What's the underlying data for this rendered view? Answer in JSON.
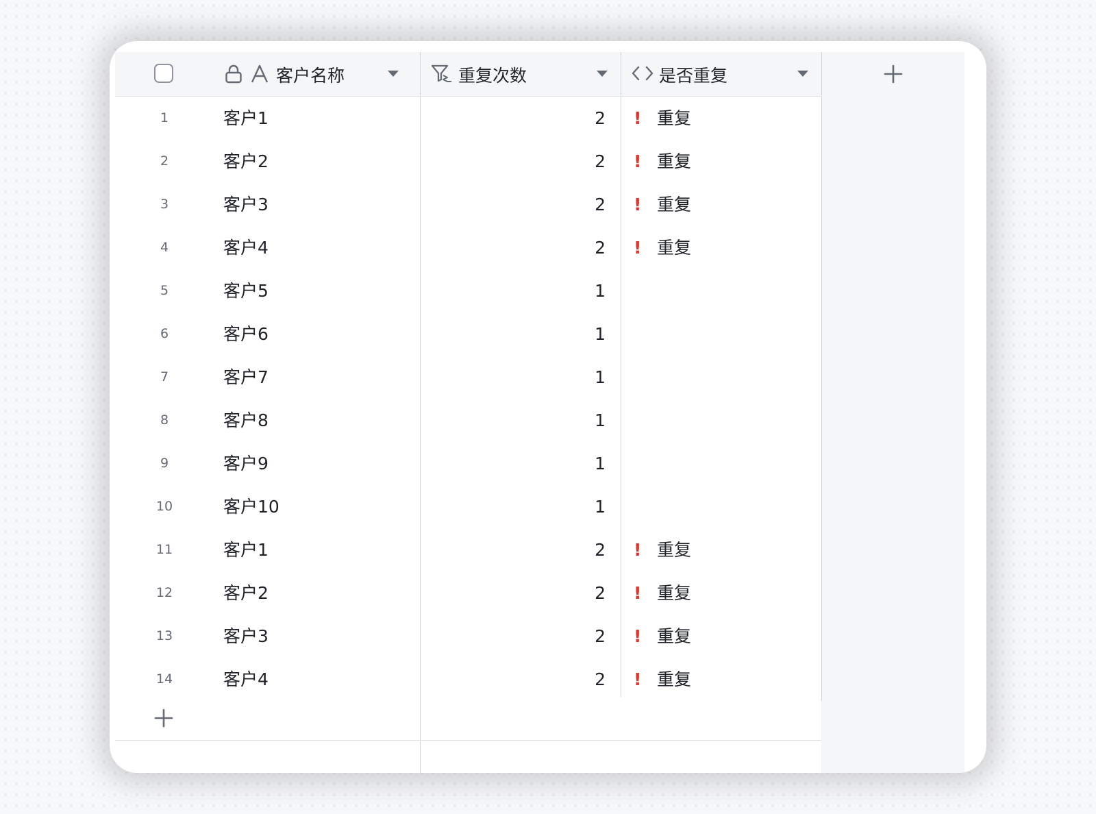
{
  "columns": {
    "name": {
      "label": "客户名称",
      "icons": [
        "lock-icon",
        "text-field-icon"
      ]
    },
    "count": {
      "label": "重复次数",
      "icons": [
        "filter-formula-icon"
      ]
    },
    "dup": {
      "label": "是否重复",
      "icons": [
        "code-icon"
      ]
    }
  },
  "colors": {
    "alert": "#d83931",
    "header_bg": "#f5f6f8",
    "border": "#dee0e3"
  },
  "rows": [
    {
      "index": "1",
      "name": "客户1",
      "count": "2",
      "flag": "!",
      "dup": "重复"
    },
    {
      "index": "2",
      "name": "客户2",
      "count": "2",
      "flag": "!",
      "dup": "重复"
    },
    {
      "index": "3",
      "name": "客户3",
      "count": "2",
      "flag": "!",
      "dup": "重复"
    },
    {
      "index": "4",
      "name": "客户4",
      "count": "2",
      "flag": "!",
      "dup": "重复"
    },
    {
      "index": "5",
      "name": "客户5",
      "count": "1",
      "flag": "",
      "dup": ""
    },
    {
      "index": "6",
      "name": "客户6",
      "count": "1",
      "flag": "",
      "dup": ""
    },
    {
      "index": "7",
      "name": "客户7",
      "count": "1",
      "flag": "",
      "dup": ""
    },
    {
      "index": "8",
      "name": "客户8",
      "count": "1",
      "flag": "",
      "dup": ""
    },
    {
      "index": "9",
      "name": "客户9",
      "count": "1",
      "flag": "",
      "dup": ""
    },
    {
      "index": "10",
      "name": "客户10",
      "count": "1",
      "flag": "",
      "dup": ""
    },
    {
      "index": "11",
      "name": "客户1",
      "count": "2",
      "flag": "!",
      "dup": "重复"
    },
    {
      "index": "12",
      "name": "客户2",
      "count": "2",
      "flag": "!",
      "dup": "重复"
    },
    {
      "index": "13",
      "name": "客户3",
      "count": "2",
      "flag": "!",
      "dup": "重复"
    },
    {
      "index": "14",
      "name": "客户4",
      "count": "2",
      "flag": "!",
      "dup": "重复"
    }
  ]
}
